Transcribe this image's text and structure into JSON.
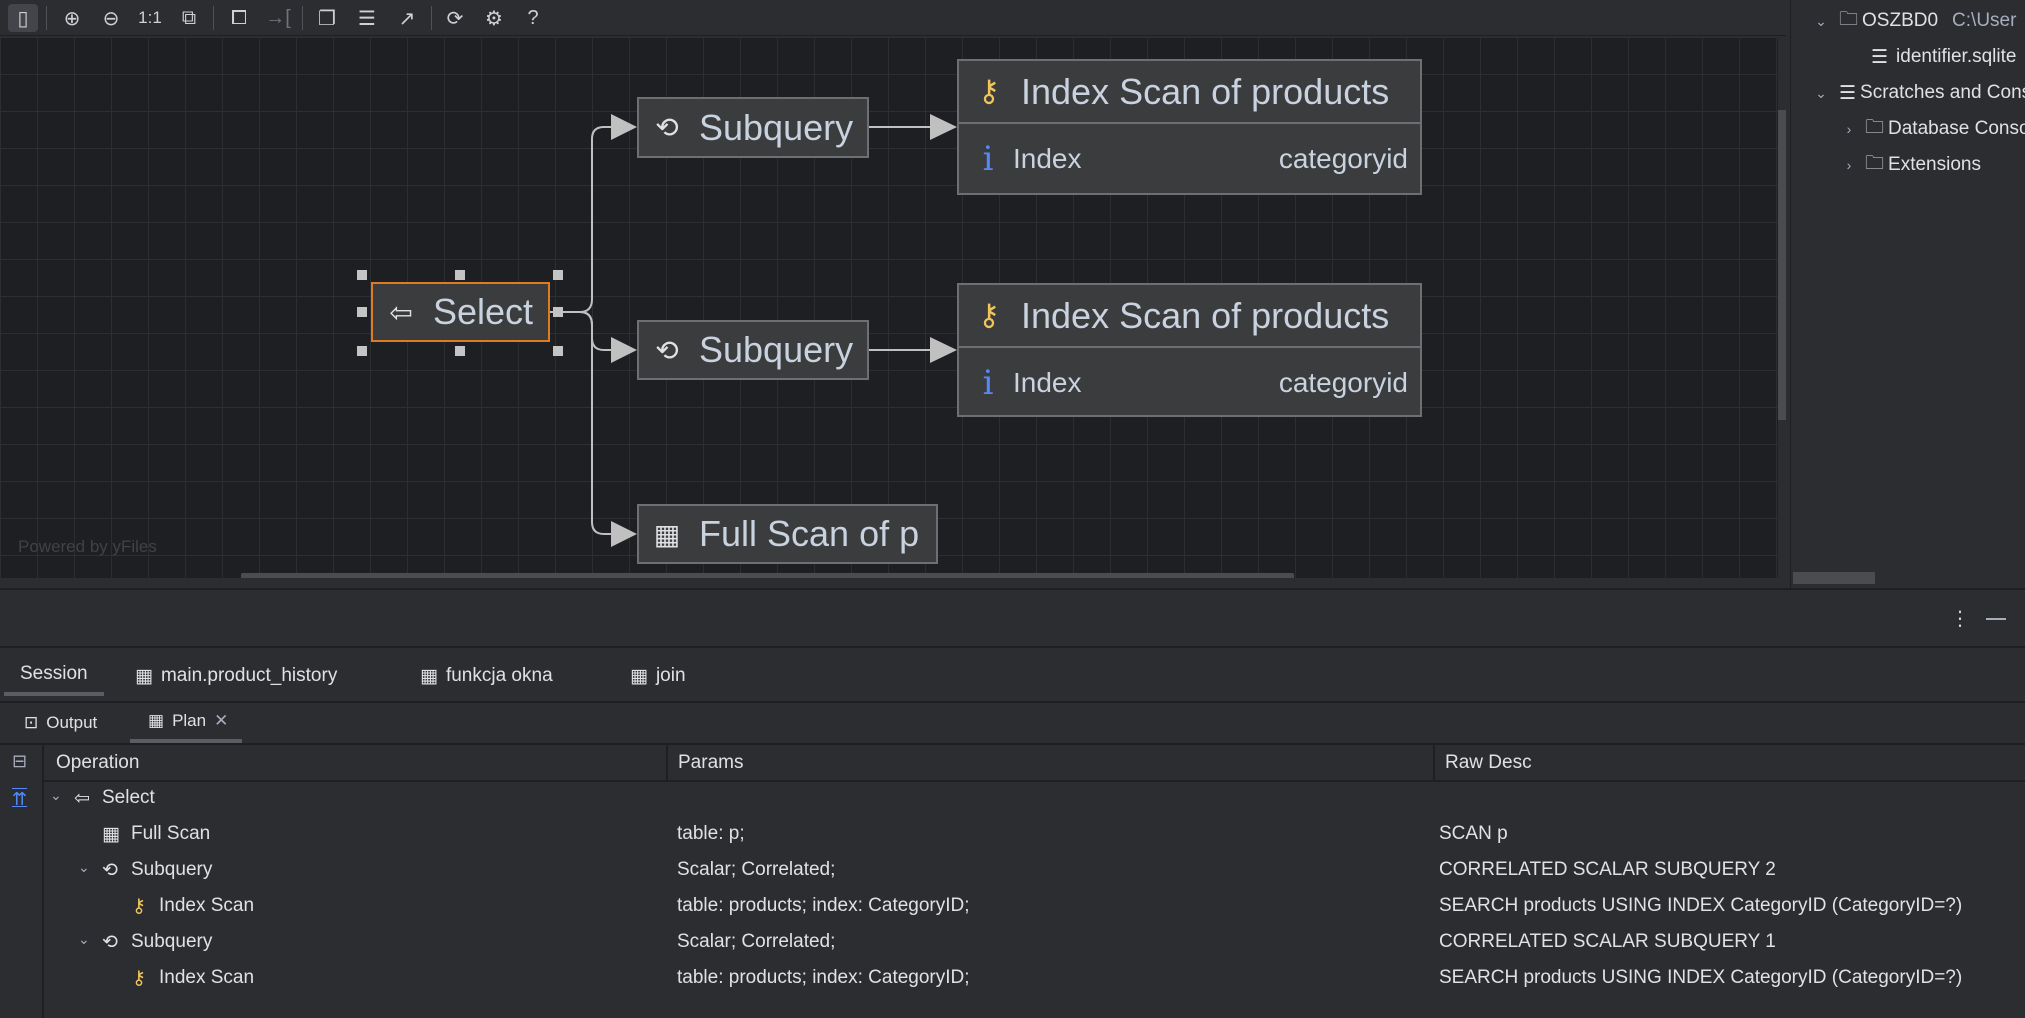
{
  "toolbar": {
    "items": [
      "sidebar-toggle",
      "zoom-in",
      "zoom-out",
      "1:1",
      "fit-content",
      "layout",
      "navigate",
      "copy",
      "text-format",
      "export",
      "refresh",
      "settings",
      "help"
    ],
    "actual_size_label": "1:1",
    "help_label": "?"
  },
  "diagram": {
    "select": {
      "label": "Select",
      "icon": "arrow-left-icon"
    },
    "subquery1": {
      "label": "Subquery",
      "icon": "refresh-icon"
    },
    "subquery2": {
      "label": "Subquery",
      "icon": "refresh-icon"
    },
    "index1": {
      "title": "Index Scan of products",
      "key": "Index",
      "value": "categoryid"
    },
    "index2": {
      "title": "Index Scan of products",
      "key": "Index",
      "value": "categoryid"
    },
    "fullscan": {
      "label": "Full Scan of p",
      "icon": "table-icon"
    },
    "watermark": "Powered by yFiles",
    "selection_color": "#e07a23"
  },
  "project": {
    "items": [
      {
        "label": "OSZBD0",
        "path": "C:\\User"
      },
      {
        "label": "identifier.sqlite"
      },
      {
        "label": "Scratches and Consoles"
      },
      {
        "label": "Database Consoles"
      },
      {
        "label": "Extensions"
      }
    ]
  },
  "services": {
    "tabs": [
      "Session",
      "main.product_history",
      "funkcja okna",
      "join"
    ],
    "subtabs": [
      "Output",
      "Plan"
    ],
    "columns": [
      "Operation",
      "Params",
      "Raw Desc"
    ],
    "rows": [
      {
        "op": "Select",
        "params": "",
        "raw": ""
      },
      {
        "op": "Full Scan",
        "params": "table: p;",
        "raw": "SCAN p"
      },
      {
        "op": "Subquery",
        "params": "Scalar; Correlated;",
        "raw": "CORRELATED SCALAR SUBQUERY 2"
      },
      {
        "op": "Index Scan",
        "params": "table: products; index: CategoryID;",
        "raw": "SEARCH products USING INDEX CategoryID (CategoryID=?)"
      },
      {
        "op": "Subquery",
        "params": "Scalar; Correlated;",
        "raw": "CORRELATED SCALAR SUBQUERY 1"
      },
      {
        "op": "Index Scan",
        "params": "table: products; index: CategoryID;",
        "raw": "SEARCH products USING INDEX CategoryID (CategoryID=?)"
      }
    ]
  }
}
